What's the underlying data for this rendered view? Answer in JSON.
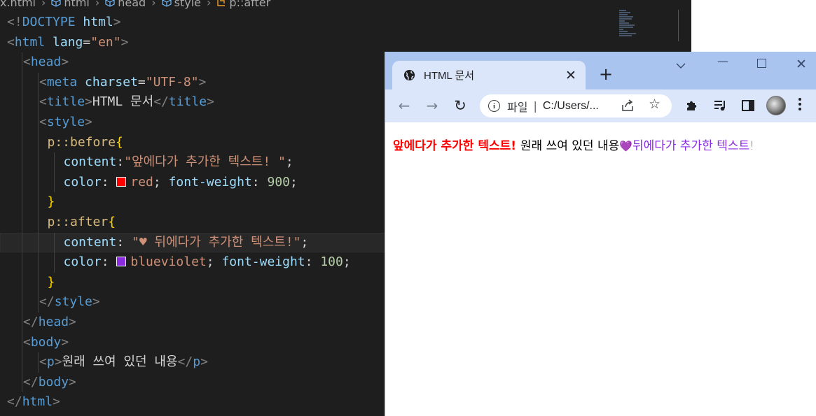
{
  "editor": {
    "breadcrumb": [
      "x.html",
      "html",
      "head",
      "style",
      "p::after"
    ],
    "lines": [
      {
        "indent": 0,
        "tokens": [
          [
            "punc",
            "<!"
          ],
          [
            "tag",
            "DOCTYPE"
          ],
          [
            "text",
            " "
          ],
          [
            "attr",
            "html"
          ],
          [
            "punc",
            ">"
          ]
        ]
      },
      {
        "indent": 0,
        "tokens": [
          [
            "punc",
            "<"
          ],
          [
            "tag",
            "html"
          ],
          [
            "text",
            " "
          ],
          [
            "attr",
            "lang"
          ],
          [
            "text",
            "="
          ],
          [
            "str",
            "\"en\""
          ],
          [
            "punc",
            ">"
          ]
        ]
      },
      {
        "indent": 1,
        "tokens": [
          [
            "punc",
            "<"
          ],
          [
            "tag",
            "head"
          ],
          [
            "punc",
            ">"
          ]
        ]
      },
      {
        "indent": 2,
        "tokens": [
          [
            "punc",
            "<"
          ],
          [
            "tag",
            "meta"
          ],
          [
            "text",
            " "
          ],
          [
            "attr",
            "charset"
          ],
          [
            "text",
            "="
          ],
          [
            "str",
            "\"UTF-8\""
          ],
          [
            "punc",
            ">"
          ]
        ]
      },
      {
        "indent": 2,
        "tokens": [
          [
            "punc",
            "<"
          ],
          [
            "tag",
            "title"
          ],
          [
            "punc",
            ">"
          ],
          [
            "text",
            "HTML 문서"
          ],
          [
            "punc",
            "</"
          ],
          [
            "tag",
            "title"
          ],
          [
            "punc",
            ">"
          ]
        ]
      },
      {
        "indent": 2,
        "tokens": [
          [
            "punc",
            "<"
          ],
          [
            "tag",
            "style"
          ],
          [
            "punc",
            ">"
          ]
        ]
      },
      {
        "indent": 2.5,
        "tokens": [
          [
            "sel",
            "p::before"
          ],
          [
            "brace",
            "{"
          ]
        ]
      },
      {
        "indent": 3.5,
        "tokens": [
          [
            "prop",
            "content"
          ],
          [
            "text",
            ":"
          ],
          [
            "val",
            "\"앞에다가 추가한 텍스트! \""
          ],
          [
            "text",
            ";"
          ]
        ]
      },
      {
        "indent": 3.5,
        "tokens": [
          [
            "prop",
            "color"
          ],
          [
            "text",
            ": "
          ],
          [
            "swatch",
            "#ff0000"
          ],
          [
            "val",
            "red"
          ],
          [
            "text",
            "; "
          ],
          [
            "prop",
            "font-weight"
          ],
          [
            "text",
            ": "
          ],
          [
            "num",
            "900"
          ],
          [
            "text",
            ";"
          ]
        ]
      },
      {
        "indent": 2.5,
        "tokens": [
          [
            "brace",
            "}"
          ]
        ]
      },
      {
        "indent": 2.5,
        "tokens": [
          [
            "sel",
            "p::after"
          ],
          [
            "brace",
            "{"
          ]
        ]
      },
      {
        "indent": 3.5,
        "current": true,
        "tokens": [
          [
            "prop",
            "content"
          ],
          [
            "text",
            ": "
          ],
          [
            "val",
            "\"♥ 뒤에다가 추가한 텍스트!\""
          ],
          [
            "text",
            ";"
          ]
        ]
      },
      {
        "indent": 3.5,
        "tokens": [
          [
            "prop",
            "color"
          ],
          [
            "text",
            ": "
          ],
          [
            "swatch",
            "#8a2be2"
          ],
          [
            "val",
            "blueviolet"
          ],
          [
            "text",
            "; "
          ],
          [
            "prop",
            "font-weight"
          ],
          [
            "text",
            ": "
          ],
          [
            "num",
            "100"
          ],
          [
            "text",
            ";"
          ]
        ]
      },
      {
        "indent": 2.5,
        "tokens": [
          [
            "brace",
            "}"
          ]
        ]
      },
      {
        "indent": 2,
        "tokens": [
          [
            "punc",
            "</"
          ],
          [
            "tag",
            "style"
          ],
          [
            "punc",
            ">"
          ]
        ]
      },
      {
        "indent": 1,
        "tokens": [
          [
            "punc",
            "</"
          ],
          [
            "tag",
            "head"
          ],
          [
            "punc",
            ">"
          ]
        ]
      },
      {
        "indent": 1,
        "tokens": [
          [
            "punc",
            "<"
          ],
          [
            "tag",
            "body"
          ],
          [
            "punc",
            ">"
          ]
        ]
      },
      {
        "indent": 2,
        "tokens": [
          [
            "punc",
            "<"
          ],
          [
            "tag",
            "p"
          ],
          [
            "punc",
            ">"
          ],
          [
            "text",
            "원래 쓰여 있던 내용"
          ],
          [
            "punc",
            "</"
          ],
          [
            "tag",
            "p"
          ],
          [
            "punc",
            ">"
          ]
        ]
      },
      {
        "indent": 1,
        "tokens": [
          [
            "punc",
            "</"
          ],
          [
            "tag",
            "body"
          ],
          [
            "punc",
            ">"
          ]
        ]
      },
      {
        "indent": 0,
        "tokens": [
          [
            "punc",
            "</"
          ],
          [
            "tag",
            "html"
          ],
          [
            "punc",
            ">"
          ]
        ]
      }
    ]
  },
  "browser": {
    "tab_title": "HTML 문서",
    "tab_close": "✕",
    "new_tab": "+",
    "window_controls": {
      "tab_search": "⌄",
      "minimize": "—",
      "close": "✕"
    },
    "nav": {
      "back": "←",
      "forward": "→",
      "reload": "↻"
    },
    "omnibox": {
      "info": "i",
      "scheme_label": "파일",
      "separator": "|",
      "url": "C:/Users/..."
    },
    "star": "☆",
    "page": {
      "before": "앞에다가 추가한 텍스트! ",
      "original": "원래 쓰여 있던 내용",
      "heart": "💜",
      "after": "뒤에다가 추가한 텍스트!"
    }
  },
  "colors": {
    "editor_bg": "#1e1e1e",
    "titlebar_bg": "#a8c4ef",
    "tab_bg": "#dbe6fb",
    "before_color": "#ff0000",
    "after_color": "#8a2be2"
  }
}
